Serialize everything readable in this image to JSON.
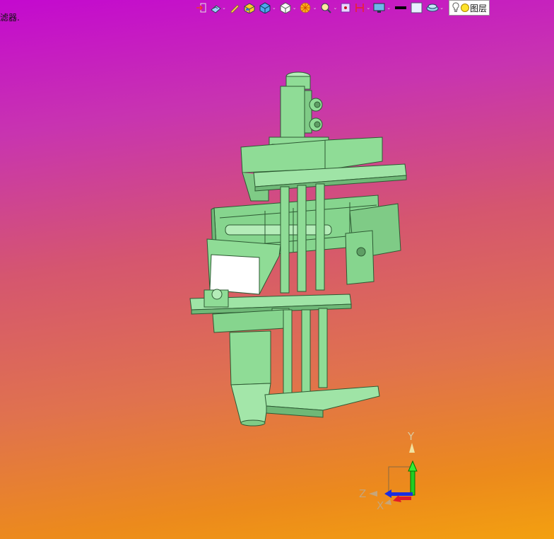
{
  "header": {
    "filter_label": "滤器."
  },
  "toolbar": {
    "layer_label": "图层",
    "items": [
      {
        "icon": "exit-icon"
      },
      {
        "icon": "view-icon"
      },
      {
        "icon": "pencil-icon"
      },
      {
        "icon": "shaded-box-icon"
      },
      {
        "icon": "cube-icon"
      },
      {
        "icon": "white-cube-icon"
      },
      {
        "icon": "render-icon"
      },
      {
        "icon": "zoom-icon"
      },
      {
        "icon": "frame-icon"
      },
      {
        "icon": "dimension-icon"
      },
      {
        "icon": "monitor-icon"
      },
      {
        "icon": "black-line-icon"
      },
      {
        "icon": "white-square-icon"
      },
      {
        "icon": "layer-icon"
      },
      {
        "icon": "lightbulb-icon"
      }
    ]
  },
  "axis": {
    "x": "X",
    "y": "Y",
    "z": "Z"
  },
  "colors": {
    "model": "#8fdc96",
    "model_dark": "#2d5a33"
  }
}
